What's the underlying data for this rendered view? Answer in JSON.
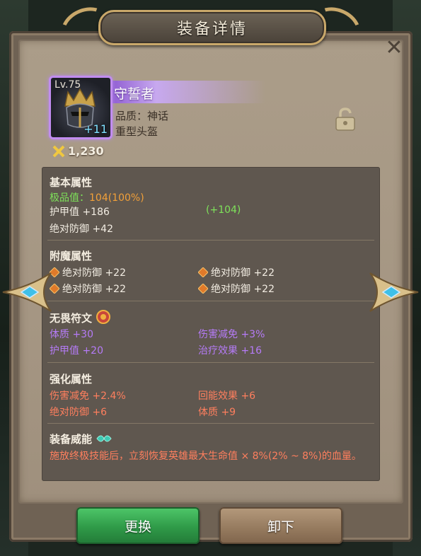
{
  "header": {
    "title": "装备详情"
  },
  "item": {
    "level": "Lv.75",
    "enhance": "+11",
    "name": "守誓者",
    "quality": "品质：神话",
    "type": "重型头盔",
    "power": "1,230"
  },
  "basic": {
    "title": "基本属性",
    "grade_label": "极品值：",
    "grade_value": "104(100%)",
    "armor": "护甲值 +186",
    "armor_bonus": "(+104)",
    "abs_def": "绝对防御 +42"
  },
  "enchant": {
    "title": "附魔属性",
    "stats": [
      "绝对防御 +22",
      "绝对防御 +22",
      "绝对防御 +22",
      "绝对防御 +22"
    ]
  },
  "rune": {
    "title": "无畏符文",
    "stats": [
      "体质 +30",
      "伤害减免 +3%",
      "护甲值 +20",
      "治疗效果 +16"
    ]
  },
  "reinforce": {
    "title": "强化属性",
    "stats": [
      "伤害减免 +2.4%",
      "回能效果 +6",
      "绝对防御 +6",
      "体质 +9"
    ]
  },
  "power_ability": {
    "title": "装备威能",
    "desc": "施放终极技能后，立刻恢复英雄最大生命值 × 8%(2% ~ 8%)的血量。"
  },
  "buttons": {
    "replace": "更换",
    "unequip": "卸下"
  },
  "icons": [
    "close-icon",
    "helmet-icon",
    "lock-icon",
    "power-icon",
    "rune-diamond-icon",
    "rune-medal-icon",
    "power-gem-icon",
    "arrow-left-icon",
    "arrow-right-icon"
  ],
  "colors": {
    "green": "#7ee25a",
    "orange": "#f2a039",
    "purple": "#b57bf7",
    "coral": "#ff7f5e",
    "mythic": "#c18cf0"
  }
}
